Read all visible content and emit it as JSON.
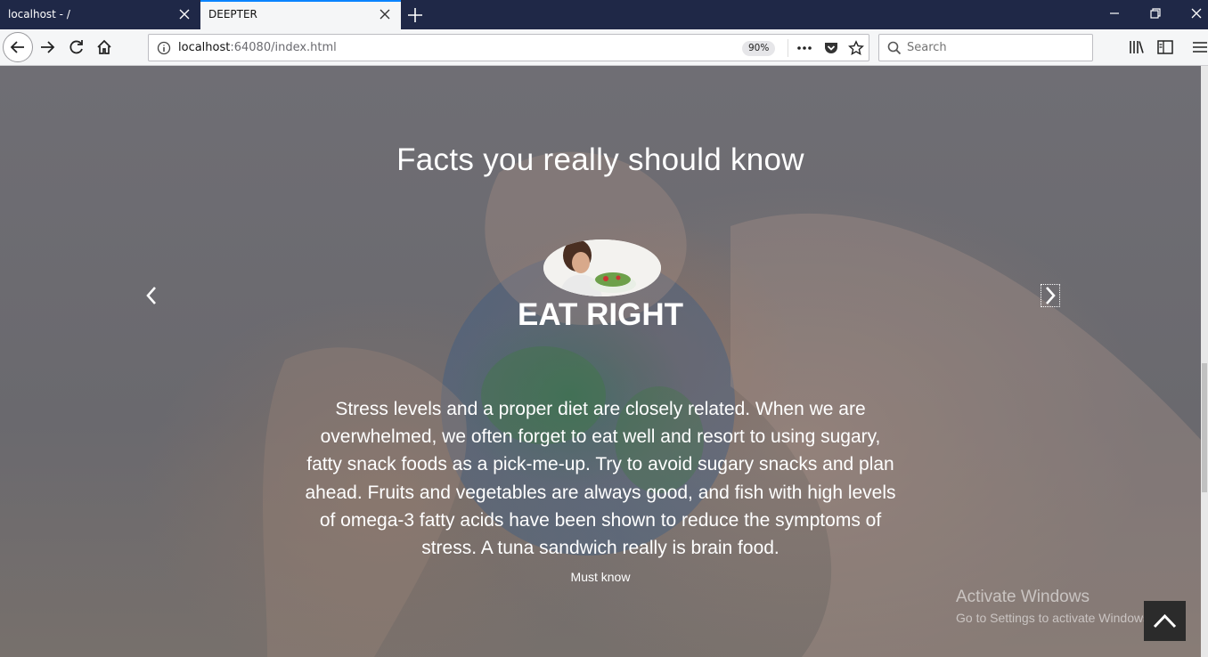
{
  "browser": {
    "tabs": [
      {
        "title": "localhost - /",
        "active": false
      },
      {
        "title": "DEEPTER",
        "active": true
      }
    ],
    "url_host": "localhost",
    "url_rest": ":64080/index.html",
    "zoom": "90%",
    "search_placeholder": "Search"
  },
  "page": {
    "heading": "Facts you really should know",
    "slide": {
      "title": "EAT RIGHT",
      "text": "Stress levels and a proper diet are closely related. When we are overwhelmed, we often forget to eat well and resort to using sugary, fatty snack foods as a pick-me-up. Try to avoid sugary snacks and plan ahead. Fruits and vegetables are always good, and fish with high levels of omega-3 fatty acids have been shown to reduce the symptoms of stress. A tuna sandwich really is brain food.",
      "link": "Must know"
    },
    "watermark_title": "Activate Windows",
    "watermark_sub": "Go to Settings to activate Windows."
  },
  "colors": {
    "tabstrip": "#1f2847",
    "accent": "#0a84ff"
  }
}
